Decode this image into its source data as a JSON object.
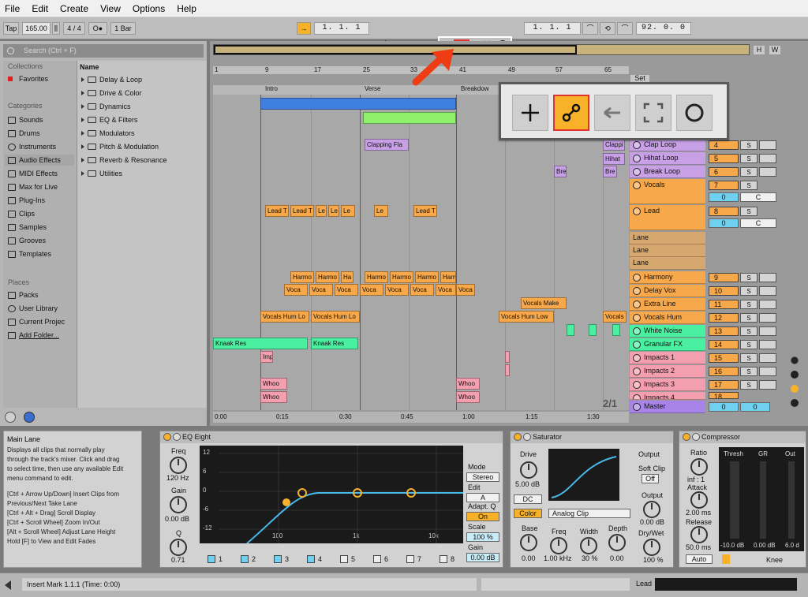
{
  "menu": [
    "File",
    "Edit",
    "Create",
    "View",
    "Options",
    "Help"
  ],
  "transport": {
    "tap": "Tap",
    "tempo": "165.00",
    "time_sig": "4 / 4",
    "quantize": "1 Bar",
    "metronome": "O●",
    "position": "1.  1.  1",
    "loop_start": "1.  1.  1",
    "loop_length": "92.  0.  0"
  },
  "browser": {
    "search_placeholder": "Search (Ctrl + F)",
    "collections_header": "Collections",
    "favorites": "Favorites",
    "categories_header": "Categories",
    "categories": [
      "Sounds",
      "Drums",
      "Instruments",
      "Audio Effects",
      "MIDI Effects",
      "Max for Live",
      "Plug-Ins",
      "Clips",
      "Samples",
      "Grooves",
      "Templates"
    ],
    "places_header": "Places",
    "places": [
      "Packs",
      "User Library",
      "Current Projec",
      "Add Folder..."
    ],
    "name_header": "Name",
    "items": [
      "Delay & Loop",
      "Drive & Color",
      "Dynamics",
      "EQ & Filters",
      "Modulators",
      "Pitch & Modulation",
      "Reverb & Resonance",
      "Utilities"
    ]
  },
  "arrangement": {
    "ruler": [
      "1",
      "9",
      "17",
      "25",
      "33",
      "41",
      "49",
      "57",
      "65"
    ],
    "locators": [
      "Intro",
      "Verse",
      "Breakdow"
    ],
    "set_button": "Set",
    "page": "2/1",
    "times": [
      "0:00",
      "0:15",
      "0:30",
      "0:45",
      "1:00",
      "1:15",
      "1:30"
    ],
    "overview_buttons": [
      "H",
      "W"
    ],
    "clips": {
      "clapping": "Clapping Fla",
      "lead_long": "Lead T",
      "lead": "Le",
      "harmony_long": "Harmo",
      "harmony": "Ha",
      "vocals": "Voca",
      "vocals_make": "Vocals Make",
      "vocals_hum": "Vocals Hum Lo",
      "vocals_hum_low": "Vocals Hum Low",
      "knaak": "Knaak Res",
      "whoosh": "Whoo",
      "impact": "Imp",
      "hihat": "Hihat",
      "brk": "Bre",
      "clappi": "Clappi"
    }
  },
  "tracks": [
    {
      "name": "Clap Loop",
      "num": "4"
    },
    {
      "name": "Hihat Loop",
      "num": "5"
    },
    {
      "name": "Break Loop",
      "num": "6"
    },
    {
      "name": "Vocals",
      "num": "7"
    },
    {
      "name": "Lead",
      "num": "8"
    },
    {
      "name": "Lane",
      "num": ""
    },
    {
      "name": "Lane",
      "num": ""
    },
    {
      "name": "Lane",
      "num": ""
    },
    {
      "name": "Harmony",
      "num": "9"
    },
    {
      "name": "Delay Vox",
      "num": "10"
    },
    {
      "name": "Extra Line",
      "num": "11"
    },
    {
      "name": "Vocals Hum",
      "num": "12"
    },
    {
      "name": "White Noise",
      "num": "13"
    },
    {
      "name": "Granular FX",
      "num": "14"
    },
    {
      "name": "Impacts 1",
      "num": "15"
    },
    {
      "name": "Impacts 2",
      "num": "16"
    },
    {
      "name": "Impacts 3",
      "num": "17"
    },
    {
      "name": "Impacts 4",
      "num": "18"
    },
    {
      "name": "Master",
      "num": "0"
    }
  ],
  "track_extra": {
    "solo": "S",
    "vol_value": "0",
    "send": "C"
  },
  "info": {
    "title": "Main Lane",
    "lines": [
      "Displays all clips that normally play",
      "through the track's mixer. Click and drag",
      "to select time, then use any available Edit",
      "menu command to edit.",
      "",
      "[Ctrl + Arrow Up/Down] Insert Clips from",
      "Previous/Next Take Lane",
      "[Ctrl + Alt + Drag] Scroll Display",
      "[Ctrl + Scroll Wheel] Zoom In/Out",
      "[Alt + Scroll Wheel] Adjust Lane Height",
      "Hold [F] to View and Edit Fades"
    ]
  },
  "eq_eight": {
    "title": "EQ Eight",
    "freq_label": "Freq",
    "freq_value": "120 Hz",
    "gain_label": "Gain",
    "gain_value": "0.00 dB",
    "q_label": "Q",
    "q_value": "0.71",
    "db_marks": [
      "12",
      "6",
      "0",
      "-6",
      "-12"
    ],
    "hz_marks": [
      "100",
      "1k",
      "10k"
    ],
    "mode_label": "Mode",
    "mode_value": "Stereo",
    "edit_label": "Edit",
    "edit_value": "A",
    "adaptq_label": "Adapt. Q",
    "adaptq_value": "On",
    "scale_label": "Scale",
    "scale_value": "100 %",
    "gain_out_label": "Gain",
    "gain_out_value": "0.00 dB",
    "bands": [
      "1",
      "2",
      "3",
      "4",
      "5",
      "6",
      "7",
      "8"
    ]
  },
  "saturator": {
    "title": "Saturator",
    "drive_label": "Drive",
    "drive_value": "5.00 dB",
    "dc": "DC",
    "color": "Color",
    "curve": "Analog Clip",
    "base_label": "Base",
    "base_value": "0.00",
    "freq_label": "Freq",
    "freq_value": "1.00 kHz",
    "width_label": "Width",
    "width_value": "30 %",
    "depth_label": "Depth",
    "depth_value": "0.00",
    "output_header": "Output",
    "softclip_label": "Soft Clip",
    "softclip_value": "Off",
    "output_label": "Output",
    "output_value": "0.00 dB",
    "drywet_label": "Dry/Wet",
    "drywet_value": "100 %"
  },
  "compressor": {
    "title": "Compressor",
    "ratio_label": "Ratio",
    "ratio_value": "inf : 1",
    "attack_label": "Attack",
    "attack_value": "2.00 ms",
    "release_label": "Release",
    "release_value": "50.0 ms",
    "auto": "Auto",
    "thresh_label": "Thresh",
    "gr_label": "GR",
    "out_label": "Out",
    "thresh_value": "-10.0 dB",
    "gr_value": "0.00 dB",
    "out_value": "6.0 d",
    "knee_label": "Knee"
  },
  "status": {
    "message": "Insert Mark 1.1.1 (Time: 0:00)",
    "track": "Lead"
  },
  "colors": {
    "accent": "#f7b22a",
    "highlight_border": "#e23232",
    "arrow": "#f03c14"
  }
}
